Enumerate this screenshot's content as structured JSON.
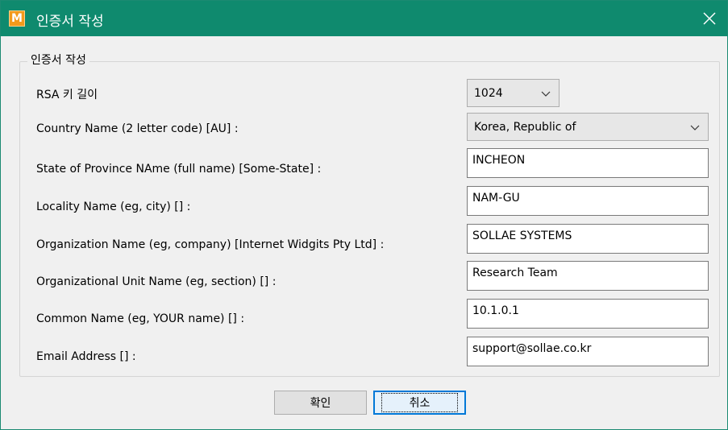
{
  "window": {
    "title": "인증서 작성",
    "app_icon_letter": "M",
    "accent": "#0f8a6e"
  },
  "group": {
    "title": "인증서 작성"
  },
  "fields": {
    "rsa_key_length": {
      "label": "RSA 키 길이",
      "value": "1024"
    },
    "country": {
      "label": "Country Name (2 letter code) [AU] :",
      "value": "Korea, Republic of"
    },
    "state": {
      "label": "State of Province NAme (full name) [Some-State] :",
      "value": "INCHEON"
    },
    "locality": {
      "label": "Locality Name (eg, city) [] :",
      "value": "NAM-GU"
    },
    "organization": {
      "label": "Organization Name (eg, company) [Internet Widgits Pty Ltd] :",
      "value": "SOLLAE SYSTEMS"
    },
    "org_unit": {
      "label": "Organizational Unit Name (eg, section) [] :",
      "value": "Research Team"
    },
    "common_name": {
      "label": "Common Name (eg, YOUR name) [] :",
      "value": "10.1.0.1"
    },
    "email": {
      "label": "Email Address [] :",
      "value": "support@sollae.co.kr"
    }
  },
  "buttons": {
    "ok": "확인",
    "cancel": "취소"
  }
}
